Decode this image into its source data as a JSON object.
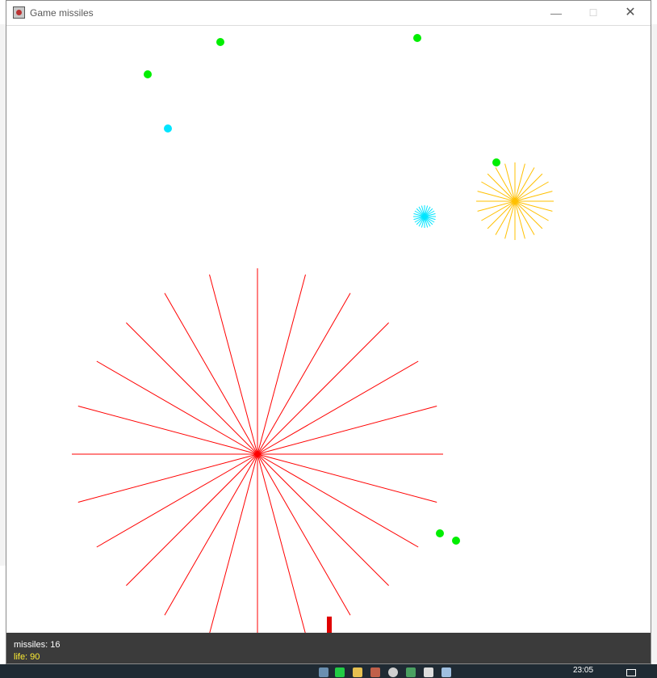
{
  "window": {
    "title": "Game missiles",
    "minimize_glyph": "—",
    "maximize_glyph": "☐",
    "close_glyph": "✕"
  },
  "status": {
    "missiles_text": "missiles: 16",
    "life_text": "life: 90"
  },
  "taskbar": {
    "clock": "23:05"
  },
  "game": {
    "enemies": [
      {
        "kind": "enemy-green",
        "color": "#00ee00"
      },
      {
        "kind": "enemy-green",
        "color": "#00ee00"
      },
      {
        "kind": "enemy-green",
        "color": "#00ee00"
      },
      {
        "kind": "enemy-cyan",
        "color": "#00e5ff"
      },
      {
        "kind": "enemy-green",
        "color": "#00ee00"
      },
      {
        "kind": "enemy-green",
        "color": "#00ee00"
      },
      {
        "kind": "enemy-green",
        "color": "#00ee00"
      }
    ],
    "explosions": [
      {
        "kind": "explosion-red",
        "color": "#ff0000",
        "rays": 24
      },
      {
        "kind": "explosion-orange",
        "color": "#ffc000",
        "rays": 24
      },
      {
        "kind": "explosion-cyan",
        "color": "#00e5ff",
        "rays": 24
      }
    ],
    "launcher": {
      "color": "#e00000"
    }
  }
}
